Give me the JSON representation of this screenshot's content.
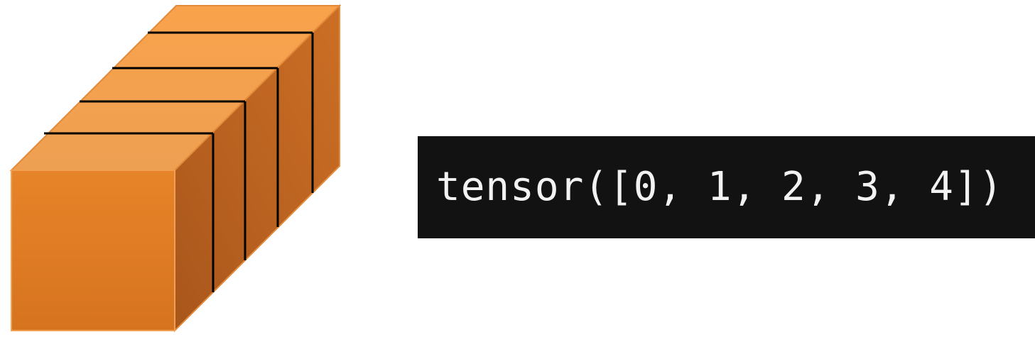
{
  "diagram": {
    "element_count": 5,
    "colors": {
      "front_face": "#e27f24",
      "top_face": "#f4a04e",
      "side_face": "#bf6521",
      "divider_line": "#000000"
    }
  },
  "output": {
    "text": "tensor([0, 1, 2, 3, 4])",
    "background": "#121212",
    "foreground": "#f2f2f2"
  }
}
